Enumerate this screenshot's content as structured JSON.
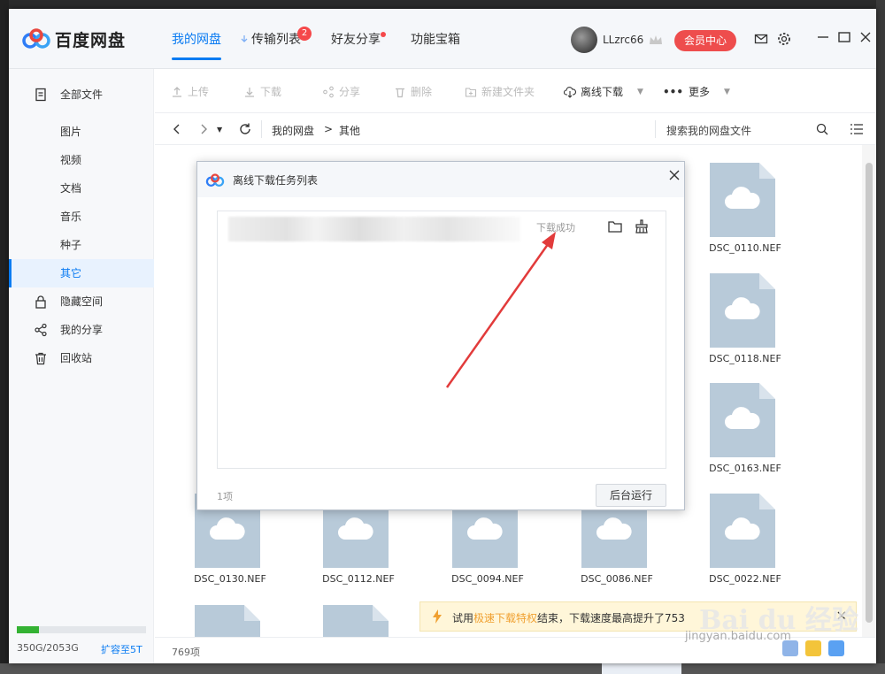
{
  "app": {
    "logo_text": "百度网盘"
  },
  "nav": {
    "tabs": [
      {
        "label": "我的网盘"
      },
      {
        "label": "传输列表",
        "badge": "2"
      },
      {
        "label": "好友分享"
      },
      {
        "label": "功能宝箱"
      }
    ]
  },
  "user": {
    "name": "LLzrc66",
    "vip_label": "会员中心"
  },
  "sidebar": {
    "items": [
      {
        "label": "全部文件",
        "icon": "document-icon"
      },
      {
        "label": "图片"
      },
      {
        "label": "视频"
      },
      {
        "label": "文档"
      },
      {
        "label": "音乐"
      },
      {
        "label": "种子"
      },
      {
        "label": "其它"
      },
      {
        "label": "隐藏空间",
        "icon": "lock-icon"
      },
      {
        "label": "我的分享",
        "icon": "share-icon"
      },
      {
        "label": "回收站",
        "icon": "trash-icon"
      }
    ],
    "quota_text": "350G/2053G",
    "quota_fraction": 0.17,
    "expand_label": "扩容至5T"
  },
  "toolbar": {
    "upload": "上传",
    "download": "下载",
    "share": "分享",
    "delete": "删除",
    "new_folder": "新建文件夹",
    "offline_download": "离线下载",
    "more": "更多"
  },
  "path": {
    "root": "我的网盘",
    "separator": ">",
    "current": "其他",
    "search_placeholder": "搜索我的网盘文件"
  },
  "files": [
    {
      "name": "DSC_0110.NEF"
    },
    {
      "name": "DSC_0118.NEF"
    },
    {
      "name": "DSC_0163.NEF"
    },
    {
      "name": "DSC_0130.NEF"
    },
    {
      "name": "DSC_0112.NEF"
    },
    {
      "name": "DSC_0094.NEF"
    },
    {
      "name": "DSC_0086.NEF"
    },
    {
      "name": "DSC_0022.NEF"
    }
  ],
  "status": {
    "count": "769项"
  },
  "notice": {
    "prefix": "试用",
    "highlight": "极速下载特权",
    "suffix": "结束，下载速度最高提升了753"
  },
  "watermark": {
    "line1": "Bai du 经验",
    "line2": "jingyan.baidu.com"
  },
  "dialog": {
    "title": "离线下载任务列表",
    "task_status": "下载成功",
    "count": "1项",
    "background_button": "后台运行"
  },
  "colors": {
    "accent": "#0a7bf2",
    "vip": "#ee4d4d",
    "badge": "#f5484a",
    "arrow": "#e23b3b"
  }
}
